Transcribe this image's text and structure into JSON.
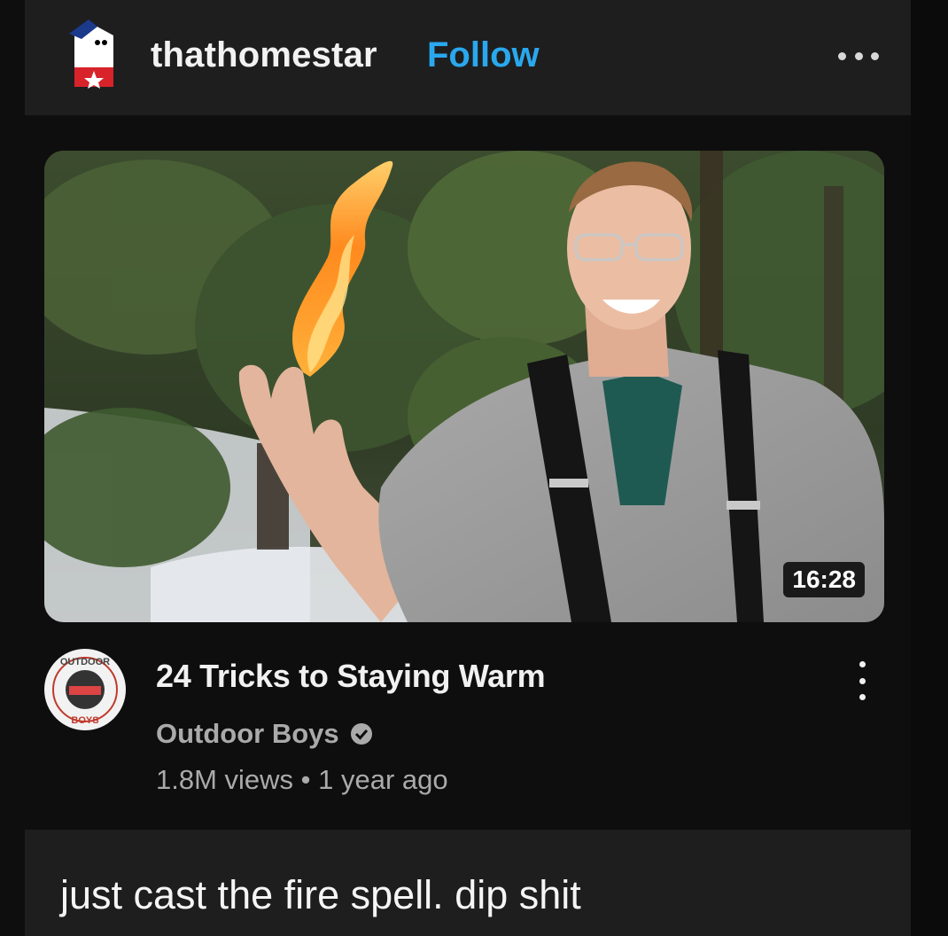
{
  "post": {
    "username": "thathomestar",
    "follow_label": "Follow",
    "avatar_icon": "homestar-avatar-icon",
    "more_icon": "more-horizontal-icon"
  },
  "video": {
    "duration": "16:28",
    "title": "24 Tricks to Staying Warm",
    "channel": "Outdoor Boys",
    "channel_logo": {
      "top_text": "OUTDOOR",
      "bottom_text": "BOYS"
    },
    "meta": "1.8M views • 1 year ago",
    "verified_icon": "verified-check-icon",
    "more_icon": "more-vertical-icon"
  },
  "reply": {
    "text": "just cast the fire spell. dip shit"
  },
  "colors": {
    "background": "#0e0e0e",
    "panel": "#1e1e1e",
    "follow": "#2aa8ee",
    "muted_text": "#aaaaaa"
  }
}
